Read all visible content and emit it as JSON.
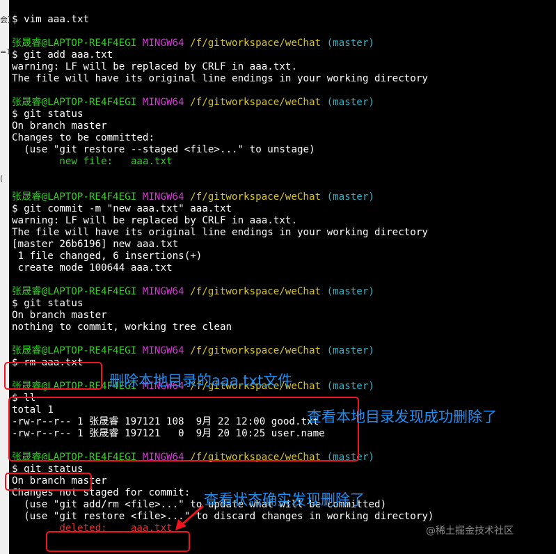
{
  "left_strip": [
    "会】",
    "=1",
    "("
  ],
  "prompt": {
    "user": "张晟睿@LAPTOP-RE4F4EGI",
    "env": "MINGW64",
    "path": "/f/gitworkspace/weChat",
    "branch": "(master)"
  },
  "lines": [
    {
      "type": "text",
      "text": "$ vim aaa.txt"
    },
    {
      "type": "blank"
    },
    {
      "type": "prompt"
    },
    {
      "type": "text",
      "text": "$ git add aaa.txt"
    },
    {
      "type": "text",
      "text": "warning: LF will be replaced by CRLF in aaa.txt."
    },
    {
      "type": "text",
      "text": "The file will have its original line endings in your working directory"
    },
    {
      "type": "blank"
    },
    {
      "type": "prompt"
    },
    {
      "type": "text",
      "text": "$ git status"
    },
    {
      "type": "text",
      "text": "On branch master"
    },
    {
      "type": "text",
      "text": "Changes to be committed:"
    },
    {
      "type": "text",
      "text": "  (use \"git restore --staged <file>...\" to unstage)"
    },
    {
      "type": "green",
      "text": "        new file:   aaa.txt"
    },
    {
      "type": "blank"
    },
    {
      "type": "blank"
    },
    {
      "type": "prompt"
    },
    {
      "type": "text",
      "text": "$ git commit -m \"new aaa.txt\" aaa.txt"
    },
    {
      "type": "text",
      "text": "warning: LF will be replaced by CRLF in aaa.txt."
    },
    {
      "type": "text",
      "text": "The file will have its original line endings in your working directory"
    },
    {
      "type": "text",
      "text": "[master 26b6196] new aaa.txt"
    },
    {
      "type": "text",
      "text": " 1 file changed, 6 insertions(+)"
    },
    {
      "type": "text",
      "text": " create mode 100644 aaa.txt"
    },
    {
      "type": "blank"
    },
    {
      "type": "prompt"
    },
    {
      "type": "text",
      "text": "$ git status"
    },
    {
      "type": "text",
      "text": "On branch master"
    },
    {
      "type": "text",
      "text": "nothing to commit, working tree clean"
    },
    {
      "type": "blank"
    },
    {
      "type": "prompt"
    },
    {
      "type": "text",
      "text": "$ rm aaa.txt"
    },
    {
      "type": "blank"
    },
    {
      "type": "prompt"
    },
    {
      "type": "text",
      "text": "$ ll"
    },
    {
      "type": "text",
      "text": "total 1"
    },
    {
      "type": "text",
      "text": "-rw-r--r-- 1 张晟睿 197121 108  9月 22 12:00 good.txt"
    },
    {
      "type": "text",
      "text": "-rw-r--r-- 1 张晟睿 197121   0  9月 20 10:25 user.name"
    },
    {
      "type": "blank"
    },
    {
      "type": "prompt"
    },
    {
      "type": "text",
      "text": "$ git status"
    },
    {
      "type": "text",
      "text": "On branch master"
    },
    {
      "type": "text",
      "text": "Changes not staged for commit:"
    },
    {
      "type": "text",
      "text": "  (use \"git add/rm <file>...\" to update what will be committed)"
    },
    {
      "type": "text",
      "text": "  (use \"git restore <file>...\" to discard changes in working directory)"
    },
    {
      "type": "red",
      "text": "        deleted:    aaa.txt"
    }
  ],
  "annotations": {
    "rm_note": "删除本地目录的aaa.txt文件",
    "ll_note": "查看本地目录发现成功删除了",
    "status_note": "查看状态确实发现删除了"
  },
  "watermark": "@稀土掘金技术社区",
  "colors": {
    "user": "#2fd11f",
    "env": "#d13bd1",
    "path": "#d7c421",
    "branch": "#2fb4c6",
    "annotation": "#1f8ef1",
    "box": "#f0141e",
    "deleted": "#e03030"
  }
}
